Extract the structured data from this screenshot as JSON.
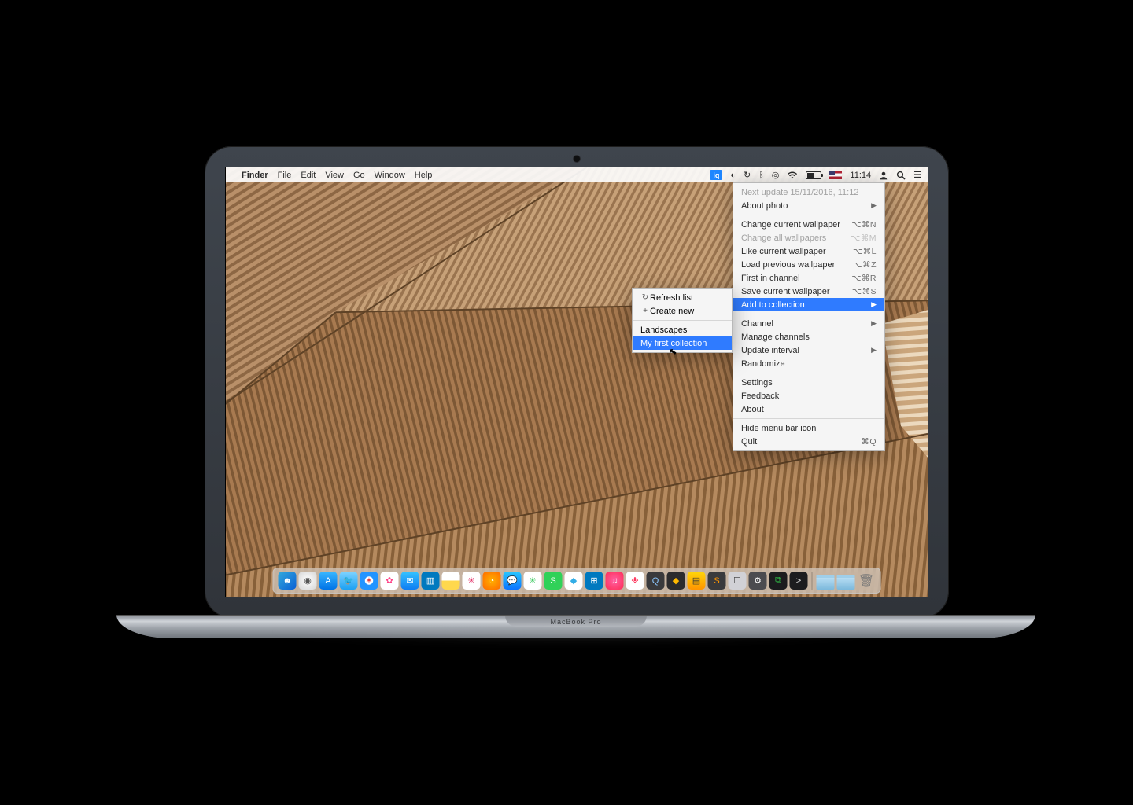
{
  "device_label": "MacBook Pro",
  "menubar": {
    "app_name": "Finder",
    "menus": [
      "File",
      "Edit",
      "View",
      "Go",
      "Window",
      "Help"
    ],
    "clock": "11:14",
    "status": {
      "app_icon_text": "iq",
      "wifi": true,
      "bluetooth": true,
      "battery_charging": true
    }
  },
  "dropdown": {
    "sections": [
      [
        {
          "label": "Next update 15/11/2016, 11:12",
          "disabled": true
        },
        {
          "label": "About photo",
          "submenu": true
        }
      ],
      [
        {
          "label": "Change current wallpaper",
          "shortcut": "⌥⌘N"
        },
        {
          "label": "Change all wallpapers",
          "shortcut": "⌥⌘M",
          "disabled": true
        },
        {
          "label": "Like current wallpaper",
          "shortcut": "⌥⌘L"
        },
        {
          "label": "Load previous wallpaper",
          "shortcut": "⌥⌘Z"
        },
        {
          "label": "First in channel",
          "shortcut": "⌥⌘R"
        },
        {
          "label": "Save current wallpaper",
          "shortcut": "⌥⌘S"
        },
        {
          "label": "Add to collection",
          "submenu": true,
          "highlight": true
        }
      ],
      [
        {
          "label": "Channel",
          "submenu": true
        },
        {
          "label": "Manage channels"
        },
        {
          "label": "Update interval",
          "submenu": true
        },
        {
          "label": "Randomize"
        }
      ],
      [
        {
          "label": "Settings"
        },
        {
          "label": "Feedback"
        },
        {
          "label": "About"
        }
      ],
      [
        {
          "label": "Hide menu bar icon"
        },
        {
          "label": "Quit",
          "shortcut": "⌘Q"
        }
      ]
    ]
  },
  "submenu": {
    "items_top": [
      {
        "pre": "↻",
        "label": "Refresh list"
      },
      {
        "pre": "+",
        "label": "Create new"
      }
    ],
    "items_bottom": [
      {
        "label": "Landscapes"
      },
      {
        "label": "My first collection",
        "highlight": true
      }
    ]
  },
  "dock": {
    "apps": [
      {
        "name": "finder",
        "bg": "linear-gradient(135deg,#34aadc,#0b60d4)",
        "glyph": "☻"
      },
      {
        "name": "launchpad",
        "bg": "radial-gradient(circle,#fff,#d6d6d6)",
        "glyph": "◉",
        "fg": "#555"
      },
      {
        "name": "app-store",
        "bg": "linear-gradient(#39b7ff,#0073e6)",
        "glyph": "A"
      },
      {
        "name": "twitter",
        "bg": "linear-gradient(#7fd3ff,#1da1f2)",
        "glyph": "🐦"
      },
      {
        "name": "safari",
        "bg": "radial-gradient(circle,#fefefe 30%,#2294ff 34%)",
        "glyph": "✶",
        "fg": "#e04040"
      },
      {
        "name": "photos",
        "bg": "#fff",
        "glyph": "✿",
        "fg": "#ff4488"
      },
      {
        "name": "mail",
        "bg": "linear-gradient(#35c3ff,#0f7df2)",
        "glyph": "✉"
      },
      {
        "name": "trello",
        "bg": "#0079bf",
        "glyph": "▥"
      },
      {
        "name": "notes",
        "bg": "linear-gradient(#fff 50%,#ffd84d 50%)",
        "glyph": "",
        "fg": "#333"
      },
      {
        "name": "slack",
        "bg": "#fff",
        "glyph": "✳",
        "fg": "#e01e5a"
      },
      {
        "name": "firefox",
        "bg": "radial-gradient(circle,#ffb000,#ff6a00)",
        "glyph": "◔"
      },
      {
        "name": "messages",
        "bg": "linear-gradient(#27c7ff,#0b74ff)",
        "glyph": "💬"
      },
      {
        "name": "app1",
        "bg": "#fff",
        "glyph": "✳",
        "fg": "#34c759"
      },
      {
        "name": "sketch-cloud",
        "bg": "#30d158",
        "glyph": "S"
      },
      {
        "name": "app2",
        "bg": "#fff",
        "glyph": "◆",
        "fg": "#32ade6"
      },
      {
        "name": "trello2",
        "bg": "#0079bf",
        "glyph": "⊞"
      },
      {
        "name": "itunes",
        "bg": "radial-gradient(circle,#ff5fa2,#ff2d55)",
        "glyph": "♫"
      },
      {
        "name": "app3",
        "bg": "#fff",
        "glyph": "❉",
        "fg": "#ff2d55"
      },
      {
        "name": "quicktime",
        "bg": "#3a3a3c",
        "glyph": "Q",
        "fg": "#8bc7ff"
      },
      {
        "name": "sketch",
        "bg": "#2c2c2e",
        "glyph": "◆",
        "fg": "#ffb900"
      },
      {
        "name": "app4",
        "bg": "linear-gradient(#ffd60a,#ff9500)",
        "glyph": "▤",
        "fg": "#333"
      },
      {
        "name": "sublime",
        "bg": "#3a3a3c",
        "glyph": "S",
        "fg": "#ff9500"
      },
      {
        "name": "app5",
        "bg": "#d1d1d6",
        "glyph": "☐",
        "fg": "#333"
      },
      {
        "name": "sys-prefs",
        "bg": "#4b4b4f",
        "glyph": "⚙"
      },
      {
        "name": "activity",
        "bg": "#1c1c1e",
        "glyph": "⧉",
        "fg": "#32d74b"
      },
      {
        "name": "terminal",
        "bg": "#1c1c1e",
        "glyph": ">",
        "fg": "#eee"
      }
    ],
    "right": [
      {
        "type": "folder",
        "name": "downloads"
      },
      {
        "type": "folder",
        "name": "documents"
      },
      {
        "type": "trash",
        "name": "trash"
      }
    ]
  }
}
